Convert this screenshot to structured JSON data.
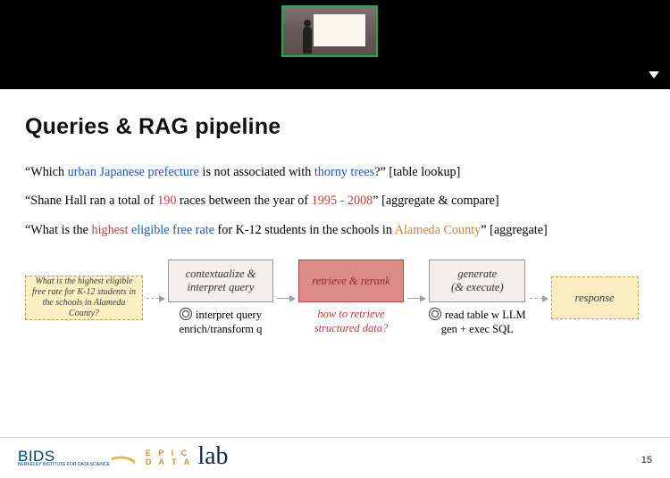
{
  "meeting": {
    "presenter_camera_label": "Presenter camera thumbnail"
  },
  "slide": {
    "title": "Queries & RAG pipeline",
    "page_number": "15",
    "queries": [
      {
        "pre": "“Which ",
        "blue1": "urban Japanese prefecture",
        "mid": " is not associated with ",
        "blue2": "thorny trees",
        "post": "?” ",
        "tag": "[table lookup]"
      },
      {
        "pre": "“Shane Hall ran a total of ",
        "red1": "190",
        "mid": " races between the year of ",
        "red2": "1995 - 2008",
        "post": "” ",
        "tag": "[aggregate & compare]"
      },
      {
        "pre": "“What is the ",
        "red1": "highest",
        "space1": " ",
        "blue1": "eligible free rate",
        "mid": " for K-12 students in the schools in ",
        "orange1": "Alameda County",
        "post": "” ",
        "tag": "[aggregate]"
      }
    ],
    "pipeline": {
      "query_box": "What is the highest eligible free rate for K-12 students in the schools in Alameda County?",
      "context_box": "contextualize & interpret query",
      "retrieve_box": "retrieve & rerank",
      "generate_box_l1": "generate",
      "generate_box_l2": "(& execute)",
      "response_box": "response",
      "caption_context_l1": "interpret query",
      "caption_context_l2": "enrich/transform q",
      "caption_retrieve_l1": "how to retrieve",
      "caption_retrieve_l2": "structured data?",
      "caption_generate_l1": "read table w LLM",
      "caption_generate_l2": "gen + exec SQL"
    },
    "footer": {
      "bids": "BIDS",
      "bids_sub": "BERKELEY INSTITUTE FOR DATA SCIENCE",
      "epic_l1": "E P I C",
      "epic_l2": "D A T A",
      "lab": "lab"
    }
  }
}
